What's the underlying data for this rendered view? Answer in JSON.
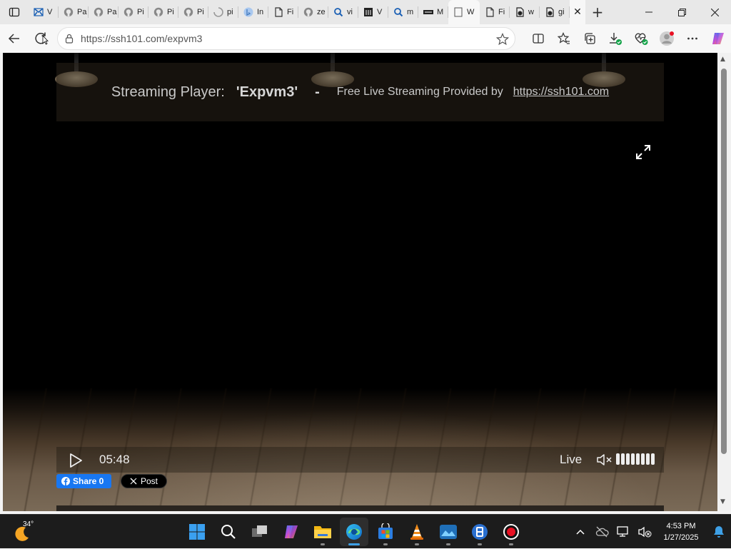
{
  "browser": {
    "tabs": [
      {
        "icon": "outlook-icon",
        "title": "V"
      },
      {
        "icon": "github-icon",
        "title": "Pa"
      },
      {
        "icon": "github-icon",
        "title": "Pa"
      },
      {
        "icon": "github-icon",
        "title": "Pi"
      },
      {
        "icon": "github-icon",
        "title": "Pi"
      },
      {
        "icon": "github-icon",
        "title": "Pi"
      },
      {
        "icon": "loading-icon",
        "title": "pi"
      },
      {
        "icon": "bing-icon",
        "title": "In"
      },
      {
        "icon": "document-icon",
        "title": "Fi"
      },
      {
        "icon": "github-icon",
        "title": "ze"
      },
      {
        "icon": "search-icon",
        "title": "vi"
      },
      {
        "icon": "archive-icon",
        "title": "V"
      },
      {
        "icon": "search-icon",
        "title": "m"
      },
      {
        "icon": "keyboard-icon",
        "title": "M"
      },
      {
        "icon": "page-icon",
        "title": "W",
        "active": true
      },
      {
        "icon": "document-icon",
        "title": "Fi"
      },
      {
        "icon": "github-file-icon",
        "title": "w"
      },
      {
        "icon": "github-file-icon",
        "title": "gi"
      }
    ],
    "address": {
      "url": "https://ssh101.com/expvm3"
    }
  },
  "page": {
    "title_prefix": "Streaming Player:",
    "stream_name": "'Expvm3'",
    "dash": "-",
    "provider_text": "Free Live Streaming Provided by",
    "provider_link": "https://ssh101.com",
    "player": {
      "time": "05:48",
      "live_label": "Live",
      "muted": true,
      "volume_level": 8
    },
    "share": {
      "facebook_label": "Share 0",
      "x_label": "Post"
    }
  },
  "taskbar": {
    "weather_temp": "34°",
    "apps": [
      "windows-start",
      "search",
      "task-view",
      "copilot",
      "file-explorer",
      "edge",
      "microsoft-store",
      "vlc",
      "photos-app",
      "vm-app",
      "screen-recorder"
    ],
    "clock_time": "4:53 PM",
    "clock_date": "1/27/2025"
  },
  "colors": {
    "facebook_blue": "#1877f2",
    "edge_indicator": "#3ea0e6",
    "recorder_red": "#e81123"
  }
}
